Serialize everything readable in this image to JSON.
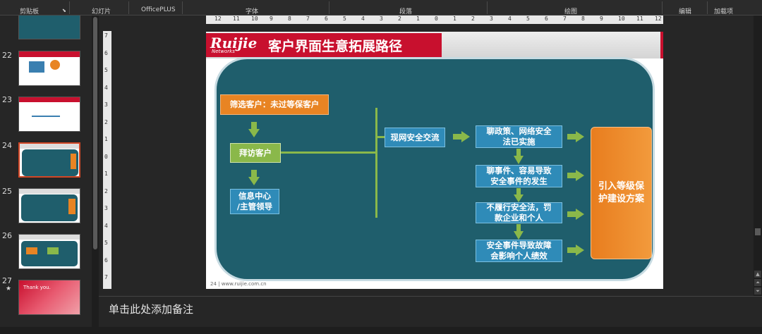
{
  "ribbon": {
    "groups": [
      "剪贴板",
      "幻灯片",
      "OfficePLUS",
      "字体",
      "段落",
      "绘图",
      "编辑",
      "加载项"
    ]
  },
  "thumbnails": [
    {
      "num": "22",
      "selected": false,
      "starred": false
    },
    {
      "num": "23",
      "selected": false,
      "starred": false
    },
    {
      "num": "24",
      "selected": true,
      "starred": false
    },
    {
      "num": "25",
      "selected": false,
      "starred": false
    },
    {
      "num": "26",
      "selected": false,
      "starred": false
    },
    {
      "num": "27",
      "selected": false,
      "starred": true,
      "thumb_text": "Thank you."
    }
  ],
  "ruler": {
    "horizontal": [
      "12",
      "11",
      "10",
      "9",
      "8",
      "7",
      "6",
      "5",
      "4",
      "3",
      "2",
      "1",
      "0",
      "1",
      "2",
      "3",
      "4",
      "5",
      "6",
      "7",
      "8",
      "9",
      "10",
      "11",
      "12"
    ],
    "vertical": [
      "7",
      "6",
      "5",
      "4",
      "3",
      "2",
      "1",
      "0",
      "1",
      "2",
      "3",
      "4",
      "5",
      "6",
      "7"
    ]
  },
  "slide": {
    "logo": "Ruijie",
    "logo_sub": "Networks",
    "title": "客户界面生意拓展路径",
    "left_boxes": {
      "filter": "筛选客户：未过等保客户",
      "visit": "拜访客户",
      "info": "信息中心\n/主管领导"
    },
    "middle_box": "现网安全交流",
    "topics": [
      "聊政策、网络安全\n法已实施",
      "聊事件、容易导致\n安全事件的发生",
      "不履行安全法，罚\n款企业和个人",
      "安全事件导致故障\n会影响个人绩效"
    ],
    "result_box": "引入等级保\n护建设方案",
    "footer": "24 | www.ruijie.com.cn"
  },
  "notes": {
    "placeholder": "单击此处添加备注"
  },
  "colors": {
    "panel": "#1f5e6c",
    "orange": "#e88423",
    "green": "#8ab84a",
    "blue": "#2f8bb8",
    "brand_red": "#c8102e"
  }
}
